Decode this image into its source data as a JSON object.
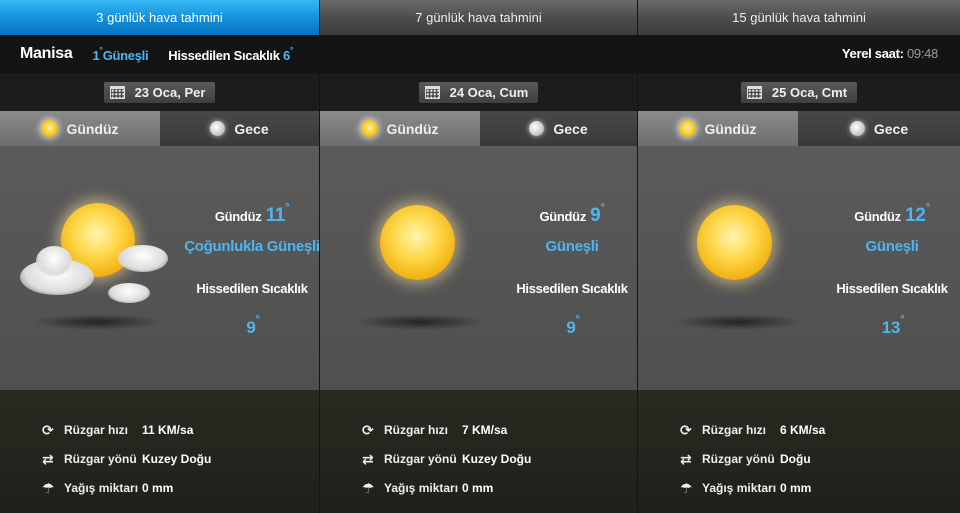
{
  "tabs": [
    {
      "label": "3 günlük hava tahmini",
      "active": true
    },
    {
      "label": "7 günlük hava tahmini",
      "active": false
    },
    {
      "label": "15 günlük hava tahmini",
      "active": false
    }
  ],
  "current": {
    "city": "Manisa",
    "temp": "1",
    "degree": "°",
    "condition": "Güneşli",
    "feels_label": "Hissedilen Sıcaklık",
    "feels_value": "6",
    "local_time_label": "Yerel saat:",
    "local_time_value": "09:48"
  },
  "days": [
    {
      "date": "23 Oca, Per",
      "day_tab": "Gündüz",
      "night_tab": "Gece",
      "day_label": "Gündüz",
      "temp": "11",
      "condition": "Çoğunlukla Güneşli",
      "feels_label": "Hissedilen Sıcaklık",
      "feels": "9",
      "icon": "partly-sunny-icon",
      "wind_speed_label": "Rüzgar hızı",
      "wind_speed": "11 KM/sa",
      "wind_dir_label": "Rüzgar yönü",
      "wind_dir": "Kuzey Doğu",
      "rain_label": "Yağış miktarı",
      "rain": "0 mm"
    },
    {
      "date": "24 Oca, Cum",
      "day_tab": "Gündüz",
      "night_tab": "Gece",
      "day_label": "Gündüz",
      "temp": "9",
      "condition": "Güneşli",
      "feels_label": "Hissedilen Sıcaklık",
      "feels": "9",
      "icon": "sun-icon",
      "wind_speed_label": "Rüzgar hızı",
      "wind_speed": "7 KM/sa",
      "wind_dir_label": "Rüzgar yönü",
      "wind_dir": "Kuzey Doğu",
      "rain_label": "Yağış miktarı",
      "rain": "0 mm"
    },
    {
      "date": "25 Oca, Cmt",
      "day_tab": "Gündüz",
      "night_tab": "Gece",
      "day_label": "Gündüz",
      "temp": "12",
      "condition": "Güneşli",
      "feels_label": "Hissedilen Sıcaklık",
      "feels": "13",
      "icon": "sun-icon",
      "wind_speed_label": "Rüzgar hızı",
      "wind_speed": "6 KM/sa",
      "wind_dir_label": "Rüzgar yönü",
      "wind_dir": "Doğu",
      "rain_label": "Yağış miktarı",
      "rain": "0 mm"
    }
  ],
  "icons": {
    "calendar": "calendar-icon",
    "day": "sun-small-icon",
    "night": "moon-icon",
    "wind_speed": "refresh-icon",
    "wind_dir": "swap-arrows-icon",
    "rain": "umbrella-icon"
  },
  "colors": {
    "accent": "#4db6f2",
    "active_tab": "#118ed8"
  }
}
